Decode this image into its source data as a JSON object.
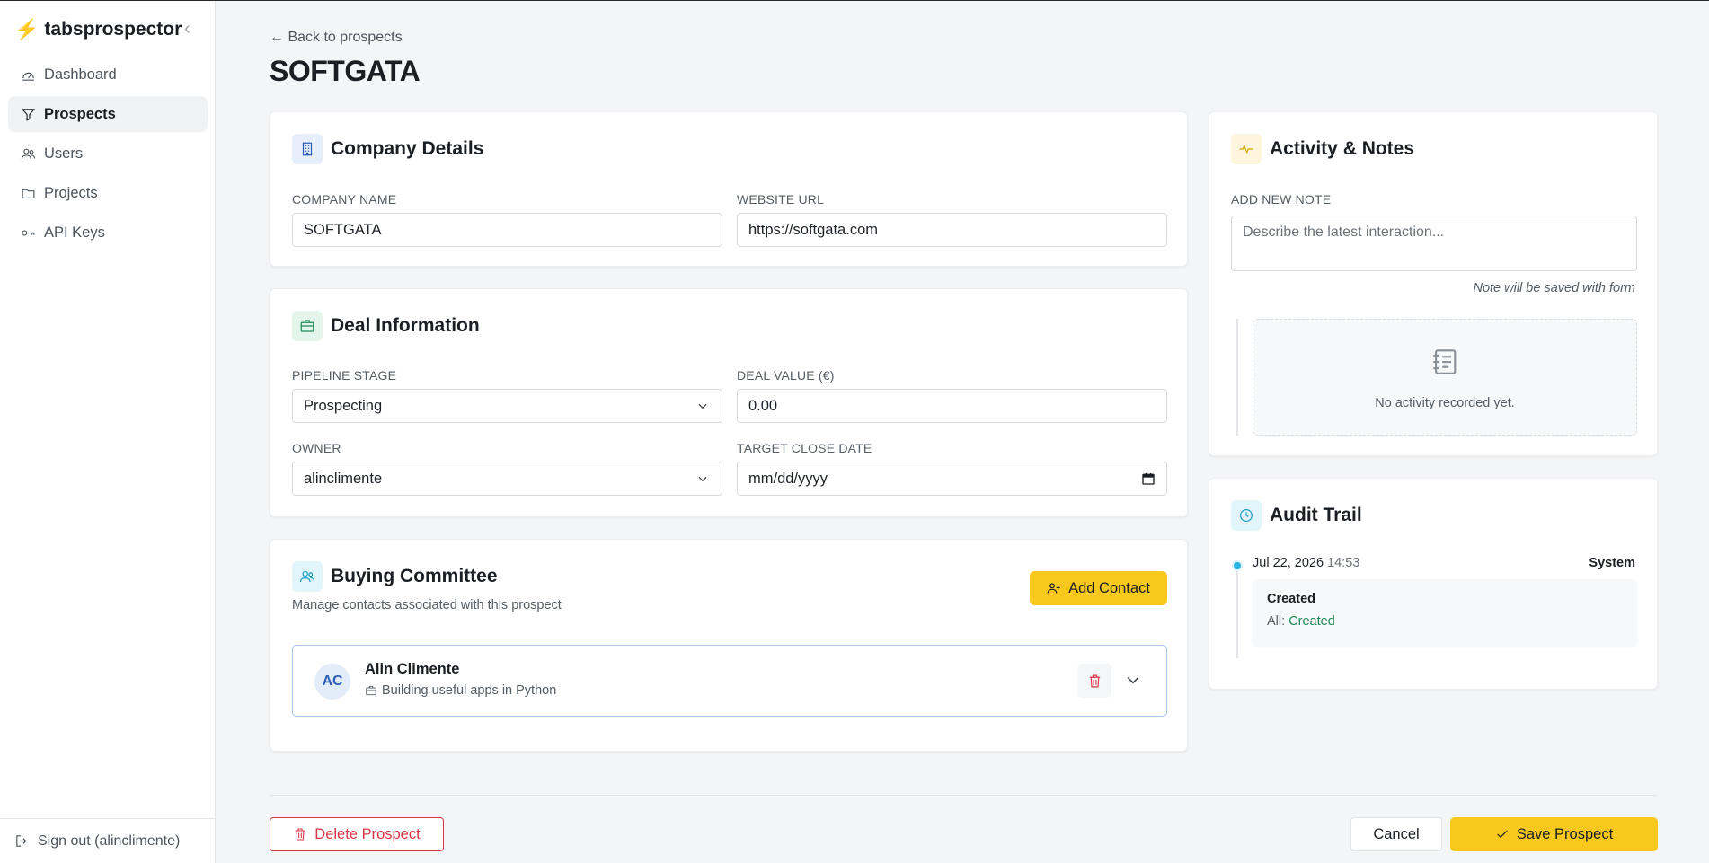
{
  "app": {
    "name": "tabsprospector"
  },
  "sidebar": {
    "items": [
      {
        "label": "Dashboard",
        "icon": "gauge-icon",
        "active": false
      },
      {
        "label": "Prospects",
        "icon": "funnel-icon",
        "active": true
      },
      {
        "label": "Users",
        "icon": "users-icon",
        "active": false
      },
      {
        "label": "Projects",
        "icon": "folder-icon",
        "active": false
      },
      {
        "label": "API Keys",
        "icon": "key-icon",
        "active": false
      }
    ],
    "signout_label": "Sign out (alinclimente)"
  },
  "header": {
    "back_label": "← Back to prospects",
    "title": "SOFTGATA"
  },
  "company": {
    "title": "Company Details",
    "name_label": "Company Name",
    "name_value": "SOFTGATA",
    "url_label": "Website URL",
    "url_value": "https://softgata.com"
  },
  "deal": {
    "title": "Deal Information",
    "stage_label": "Pipeline Stage",
    "stage_value": "Prospecting",
    "value_label": "Deal Value (€)",
    "value_value": "0.00",
    "owner_label": "Owner",
    "owner_value": "alinclimente",
    "close_label": "Target Close Date",
    "close_placeholder": "mm/dd/yyyy"
  },
  "committee": {
    "title": "Buying Committee",
    "subtitle": "Manage contacts associated with this prospect",
    "add_label": "Add Contact",
    "contacts": [
      {
        "initials": "AC",
        "name": "Alin Climente",
        "headline": "Building useful apps in Python"
      }
    ]
  },
  "activity": {
    "title": "Activity & Notes",
    "note_label": "Add New Note",
    "note_placeholder": "Describe the latest interaction...",
    "note_hint": "Note will be saved with form",
    "empty_text": "No activity recorded yet."
  },
  "audit": {
    "title": "Audit Trail",
    "entries": [
      {
        "date": "Jul 22, 2026",
        "time": "14:53",
        "actor": "System",
        "action": "Created",
        "field": "All:",
        "value": "Created"
      }
    ]
  },
  "footer": {
    "delete_label": "Delete Prospect",
    "cancel_label": "Cancel",
    "save_label": "Save Prospect"
  },
  "colors": {
    "accent": "#f8c81c",
    "danger": "#dc3545",
    "success": "#1a8a55",
    "info": "#2bb3e6"
  }
}
